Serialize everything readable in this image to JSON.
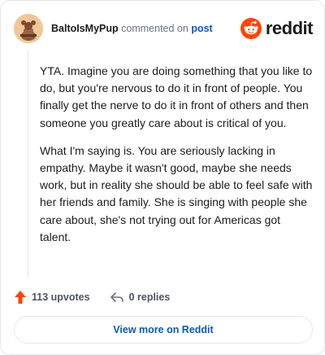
{
  "comment": {
    "author": "BaltoIsMyPup",
    "action_text": "commented on",
    "post_link": "post",
    "paragraphs": [
      "YTA. Imagine you are doing something that you like to do, but you're nervous to do it in front of people. You finally get the nerve to do it in front of others and then someone you greatly care about is critical of you.",
      "What I'm saying is. You are seriously lacking in empathy. Maybe it wasn't good, maybe she needs work, but in reality she should be able to feel safe with her friends and family. She is singing with people she care about, she's not trying out for Americas got talent."
    ],
    "upvotes": "113 upvotes",
    "replies": "0 replies"
  },
  "brand": {
    "name": "reddit",
    "color": "#ff4500"
  },
  "footer": {
    "view_more_label": "View more on Reddit"
  },
  "colors": {
    "link": "#0b5ab5",
    "upvote": "#ff4500",
    "muted": "#6b7280"
  },
  "icons": [
    "avatar-icon",
    "reddit-logo-icon",
    "upvote-arrow-icon",
    "reply-arrow-icon"
  ]
}
